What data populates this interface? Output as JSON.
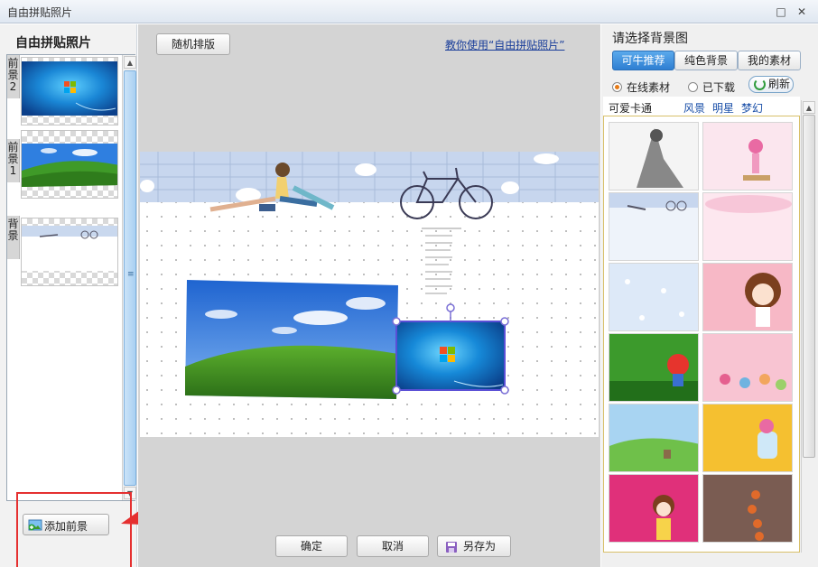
{
  "window": {
    "title": "自由拼贴照片",
    "restore_glyph": "□",
    "close_glyph": "✕"
  },
  "left": {
    "panel_title": "自由拼贴照片",
    "layers": [
      {
        "tab": "前景2"
      },
      {
        "tab": "前景1"
      },
      {
        "tab": "背景"
      }
    ],
    "add_foreground_label": "添加前景"
  },
  "center": {
    "random_layout_label": "随机排版",
    "help_link": "教你使用“自由拼贴照片”",
    "ok_label": "确定",
    "cancel_label": "取消",
    "save_as_label": "另存为"
  },
  "right": {
    "title": "请选择背景图",
    "tabs": [
      {
        "label": "可牛推荐",
        "active": true
      },
      {
        "label": "纯色背景",
        "active": false
      },
      {
        "label": "我的素材",
        "active": false
      }
    ],
    "source_options": [
      {
        "label": "在线素材",
        "selected": true
      },
      {
        "label": "已下载",
        "selected": false
      }
    ],
    "refresh_label": "刷新",
    "categories": [
      {
        "label": "可爱卡通",
        "active": true
      },
      {
        "label": "风景",
        "active": false
      },
      {
        "label": "明星",
        "active": false
      },
      {
        "label": "梦幻",
        "active": false
      }
    ]
  },
  "icons": {
    "scroll_up": "▲",
    "scroll_down": "▼",
    "grip": "≡"
  },
  "colors": {
    "accent_blue": "#2f7fd2",
    "link": "#1a3e9a",
    "highlight_red": "#e53030",
    "selection_handle": "#5a4fd6"
  }
}
